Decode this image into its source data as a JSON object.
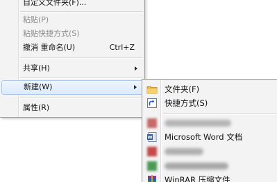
{
  "context_menu": {
    "items": [
      {
        "label": "自定义文件夹(F)...",
        "disabled": false
      },
      {
        "label": "粘贴(P)",
        "disabled": true
      },
      {
        "label": "粘贴快捷方式(S)",
        "disabled": true
      },
      {
        "label": "撤消 重命名(U)",
        "shortcut": "Ctrl+Z",
        "disabled": false
      },
      {
        "label": "共享(H)",
        "has_submenu": true
      },
      {
        "label": "新建(W)",
        "has_submenu": true,
        "highlighted": true
      },
      {
        "label": "属性(R)"
      }
    ]
  },
  "new_submenu": {
    "items": [
      {
        "label": "文件夹(F)",
        "icon": "folder-icon"
      },
      {
        "label": "快捷方式(S)",
        "icon": "shortcut-icon"
      },
      {
        "label": "",
        "icon": "blurred-icon",
        "blurred": true
      },
      {
        "label": "Microsoft Word 文档",
        "icon": "word-document-icon"
      },
      {
        "label": "",
        "icon": "blurred-icon",
        "blurred": true
      },
      {
        "label": "",
        "icon": "blurred-icon",
        "blurred": true
      },
      {
        "label": "WinRAR 压缩文件",
        "icon": "winrar-archive-icon"
      }
    ]
  },
  "colors": {
    "menu_bg": "#f3f3f3",
    "highlight_bg": "#dceafb",
    "highlight_border": "#a9c7ec",
    "disabled_text": "#8d8d8d"
  }
}
